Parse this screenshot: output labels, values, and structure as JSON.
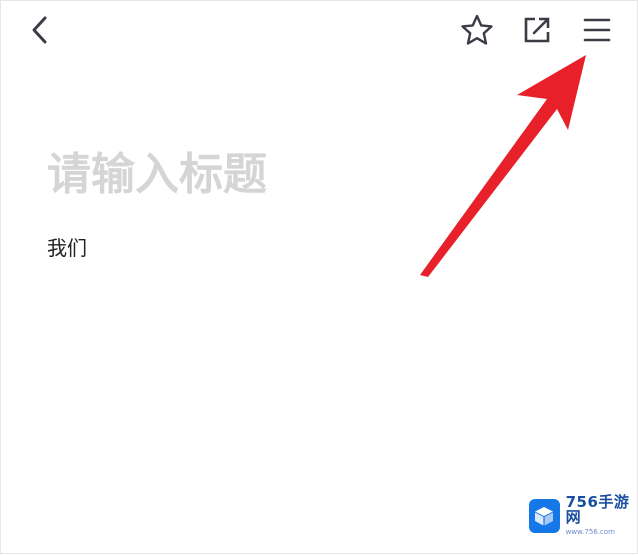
{
  "toolbar": {
    "back_icon": "chevron-left-icon",
    "favorite_icon": "star-outline-icon",
    "share_icon": "external-link-icon",
    "menu_icon": "hamburger-menu-icon"
  },
  "editor": {
    "title_placeholder": "请输入标题",
    "title_value": "",
    "body_text": "我们"
  },
  "annotation": {
    "arrow_color": "#e8202a",
    "points_to": "menu-button"
  },
  "watermark": {
    "name": "756手游网",
    "url": "www.756.com",
    "logo_color": "#1677e8"
  }
}
